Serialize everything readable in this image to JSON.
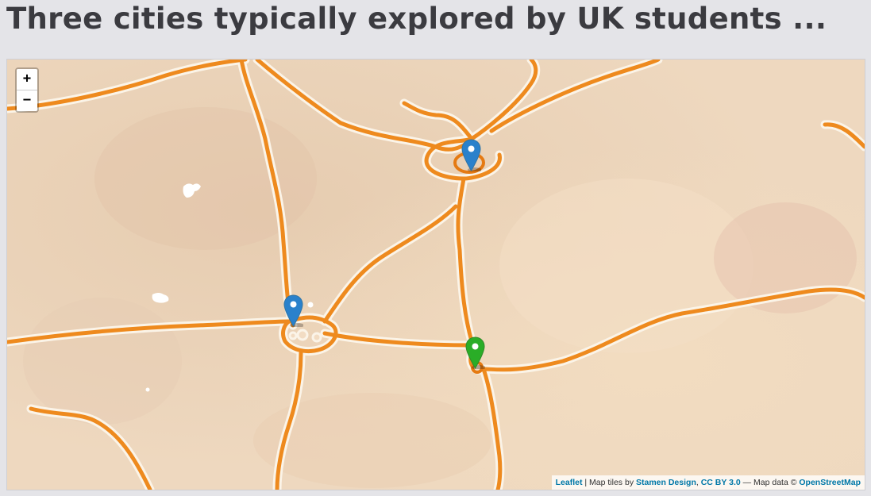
{
  "page": {
    "title": "Three cities typically explored by UK students ..."
  },
  "map": {
    "tile_style": "Stamen Watercolor",
    "zoom_in_label": "+",
    "zoom_out_label": "−",
    "markers": [
      {
        "name": "marker-north",
        "color": "#2a81cb"
      },
      {
        "name": "marker-west",
        "color": "#2a81cb"
      },
      {
        "name": "marker-east",
        "color": "#2aad27"
      }
    ],
    "colors": {
      "land": "#eed8bf",
      "road": "#ee8a1e",
      "road_halo": "#f8f1e4",
      "link": "#0078a8"
    }
  },
  "attribution": {
    "leaflet": "Leaflet",
    "sep1": " | Map tiles by ",
    "stamen": "Stamen Design",
    "comma": ", ",
    "license": "CC BY 3.0",
    "sep2": " — Map data © ",
    "osm": "OpenStreetMap"
  }
}
